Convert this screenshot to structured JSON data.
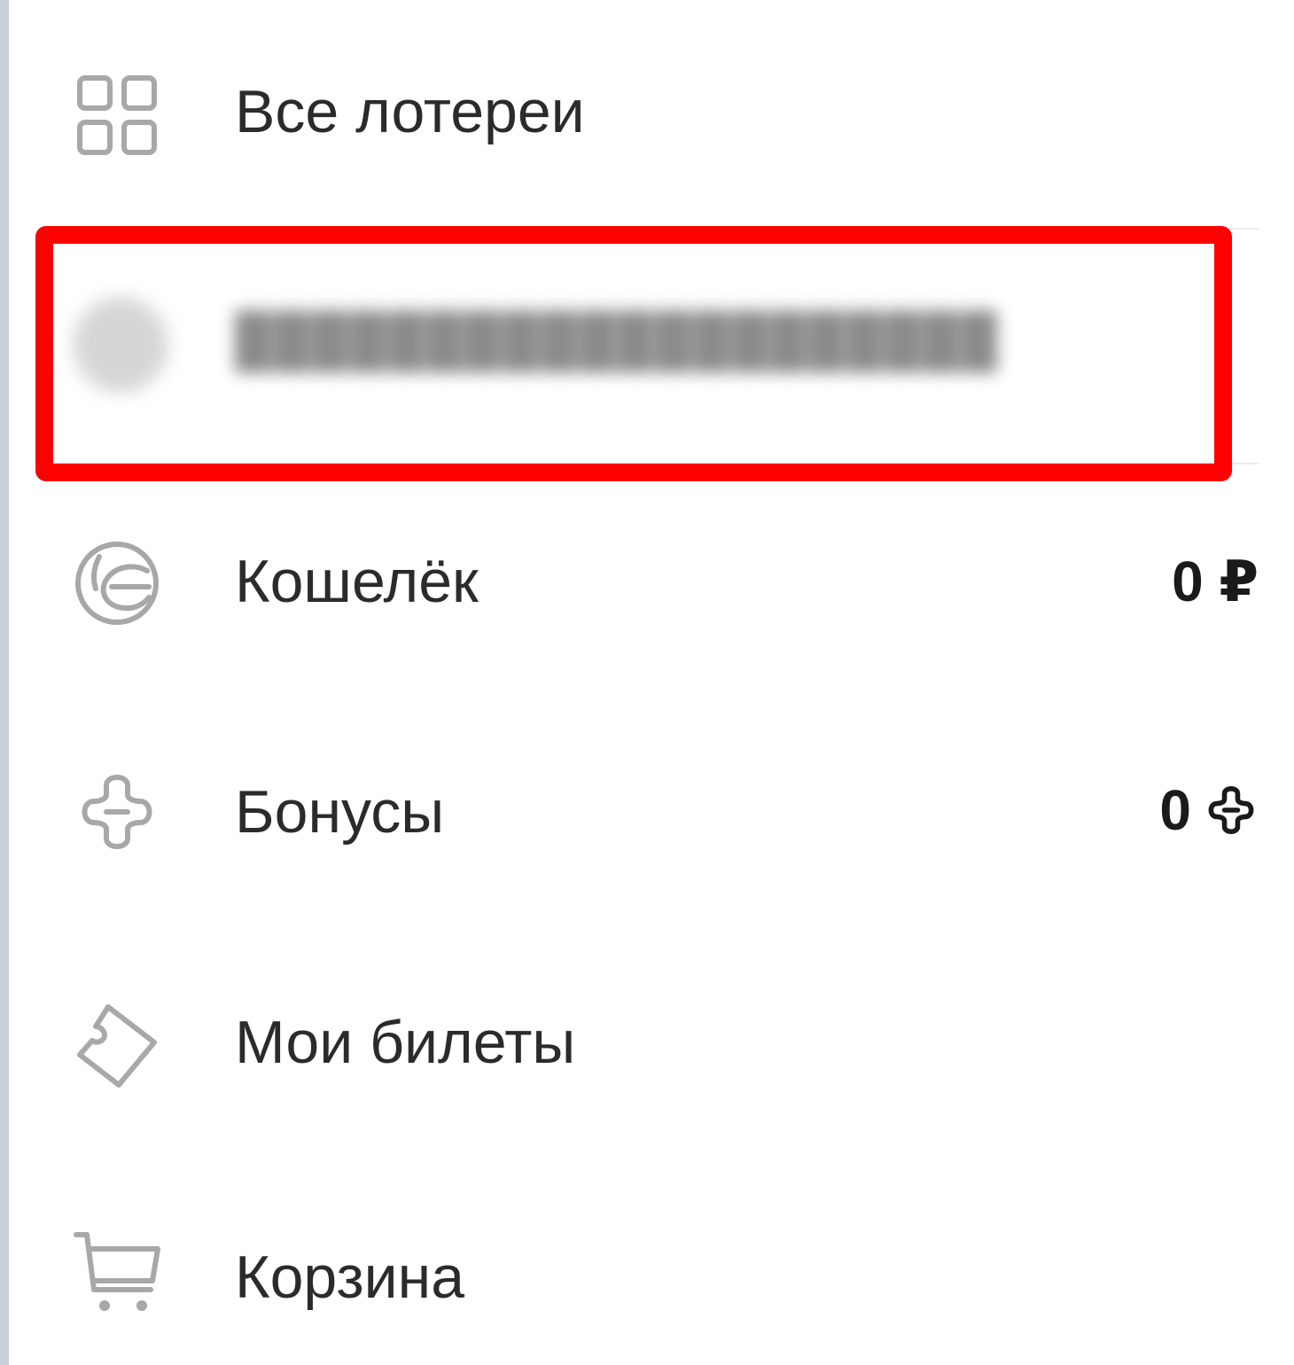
{
  "menu": {
    "all_lotteries": {
      "label": "Все лотереи",
      "icon": "grid-icon"
    },
    "account": {
      "icon": "avatar-icon"
    },
    "wallet": {
      "label": "Кошелёк",
      "value": "0 ₽",
      "icon": "wallet-icon"
    },
    "bonuses": {
      "label": "Бонусы",
      "value": "0",
      "icon": "bonus-icon"
    },
    "my_tickets": {
      "label": "Мои билеты",
      "icon": "ticket-icon"
    },
    "cart": {
      "label": "Корзина",
      "icon": "cart-icon"
    }
  },
  "colors": {
    "icon_gray": "#a8a8a8",
    "text": "#2b2b2b",
    "highlight": "#ff0000",
    "divider": "#ececec"
  }
}
